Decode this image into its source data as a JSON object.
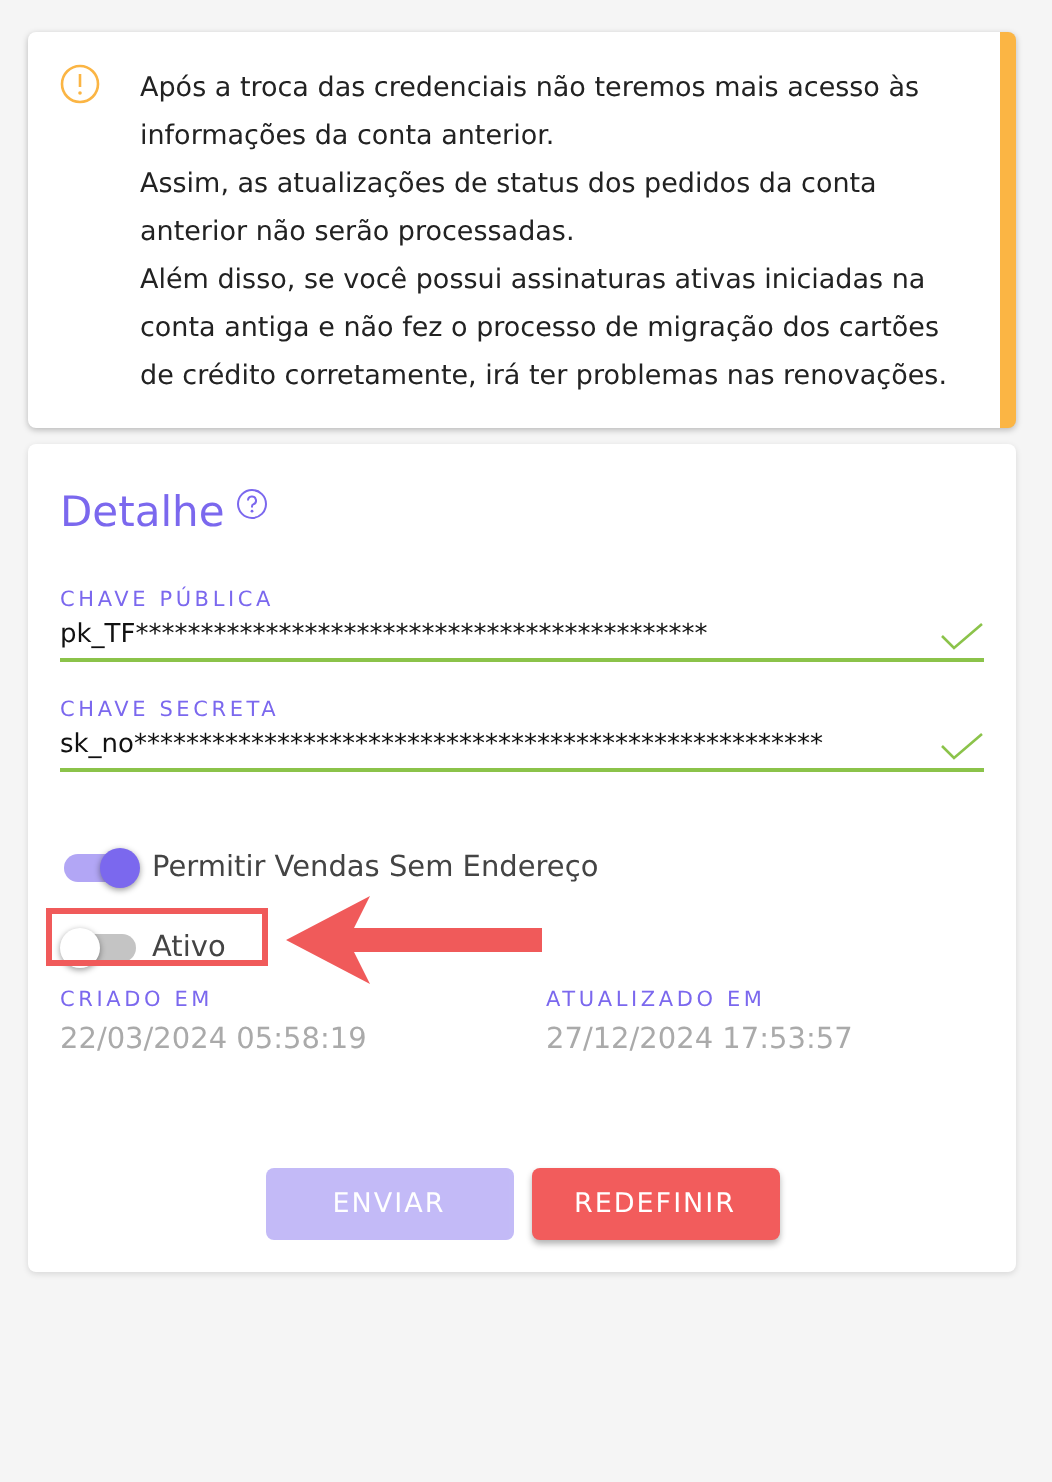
{
  "alert": {
    "paragraphs": [
      "Após a troca das credenciais não teremos mais acesso às informações da conta anterior.",
      "Assim, as atualizações de status dos pedidos da conta anterior não serão processadas.",
      "Além disso, se você possui assinaturas ativas iniciadas na conta antiga e não fez o processo de migração dos cartões de crédito corretamente, irá ter problemas nas renovações."
    ]
  },
  "detail": {
    "title": "Detalhe",
    "fields": [
      {
        "label": "CHAVE PÚBLICA",
        "value": "pk_TF********************************************",
        "valid": true
      },
      {
        "label": "CHAVE SECRETA",
        "value": "sk_no*****************************************************",
        "valid": true
      }
    ],
    "toggles": [
      {
        "label": "Permitir Vendas Sem Endereço",
        "on": true,
        "highlighted": false
      },
      {
        "label": "Ativo",
        "on": false,
        "highlighted": true
      }
    ],
    "dates": [
      {
        "label": "CRIADO EM",
        "value": "22/03/2024 05:58:19"
      },
      {
        "label": "ATUALIZADO EM",
        "value": "27/12/2024 17:53:57"
      }
    ],
    "buttons": [
      {
        "label": "ENVIAR",
        "kind": "submit",
        "disabled": true
      },
      {
        "label": "REDEFINIR",
        "kind": "reset",
        "disabled": false
      }
    ]
  }
}
